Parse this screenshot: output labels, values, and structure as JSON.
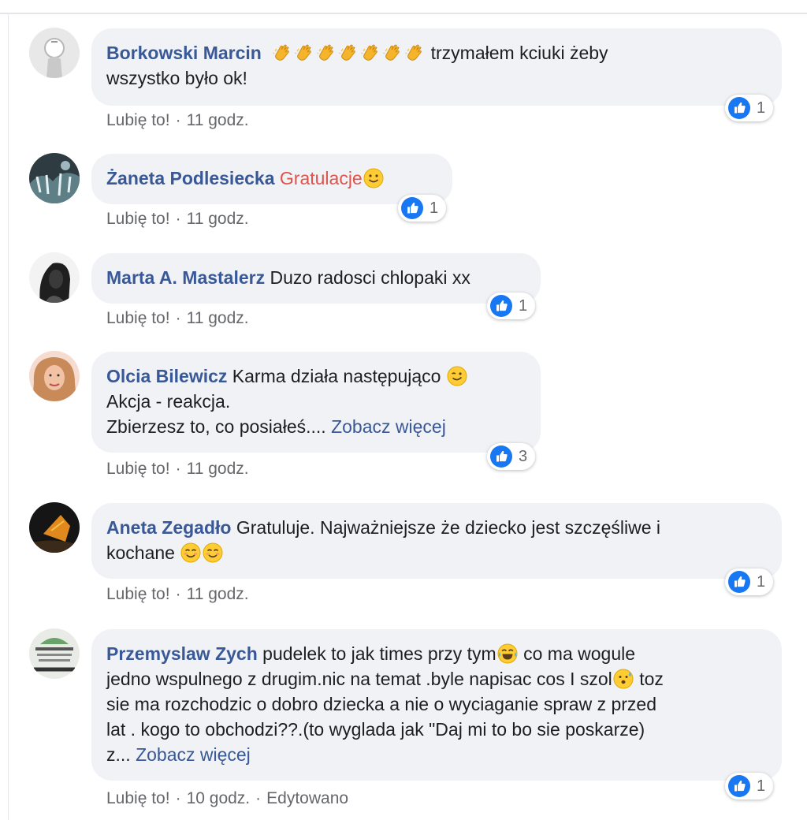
{
  "comments": [
    {
      "author": "Borkowski Marcin",
      "lines": [
        "trzymałem kciuki żeby",
        "wszystko było ok!"
      ],
      "emoji_before": [
        "clapping-hands",
        "clapping-hands",
        "clapping-hands",
        "clapping-hands",
        "clapping-hands",
        "clapping-hands",
        "clapping-hands"
      ],
      "like_label": "Lubię to!",
      "time": "11 godz.",
      "reactions": "1"
    },
    {
      "author": "Żaneta Podlesiecka",
      "lines": [
        "Gratulacje"
      ],
      "emoji_after": "slightly-smiling-face",
      "like_label": "Lubię to!",
      "time": "11 godz.",
      "reactions": "1"
    },
    {
      "author": "Marta A. Mastalerz",
      "lines": [
        "Duzo radosci chlopaki xx"
      ],
      "like_label": "Lubię to!",
      "time": "11 godz.",
      "reactions": "1"
    },
    {
      "author": "Olcia Bilewicz",
      "lines": [
        "Karma działa następująco",
        "Akcja - reakcja.",
        "Zbierzesz to, co posiałeś...."
      ],
      "emoji_after": "winking-face",
      "see_more": "Zobacz więcej",
      "like_label": "Lubię to!",
      "time": "11 godz.",
      "reactions": "3"
    },
    {
      "author": "Aneta Zegadło",
      "lines": [
        "Gratuluje. Najważniejsze że dziecko jest szczęśliwe i",
        "kochane"
      ],
      "emoji_after": [
        "smiling-face-with-smiling-eyes",
        "smiling-face-with-smiling-eyes"
      ],
      "like_label": "Lubię to!",
      "time": "11 godz.",
      "reactions": "1"
    },
    {
      "author": "Przemyslaw Zych",
      "lines": [
        "pudelek to jak times przy tym",
        "co ma wogule",
        "jedno wspulnego z drugim.nic na temat .byle napisac cos I szol",
        "toz",
        "sie ma rozchodzic o dobro dziecka a nie o wyciaganie spraw z przed",
        "lat . kogo to obchodzi??.(to wyglada jak \"Daj mi to bo sie poskarze)",
        "z..."
      ],
      "emoji_inline": [
        "face-with-tears-of-joy",
        "face-with-open-mouth-sweat"
      ],
      "see_more": "Zobacz więcej",
      "like_label": "Lubię to!",
      "time": "10 godz.",
      "edited": "Edytowano",
      "reactions": "1"
    }
  ],
  "separator": "·",
  "colors": {
    "bubble_bg": "#f0f2f5",
    "author": "#385898",
    "meta_text": "#65676b",
    "like_blue": "#1877f2",
    "coral_text": "#e0534b"
  }
}
